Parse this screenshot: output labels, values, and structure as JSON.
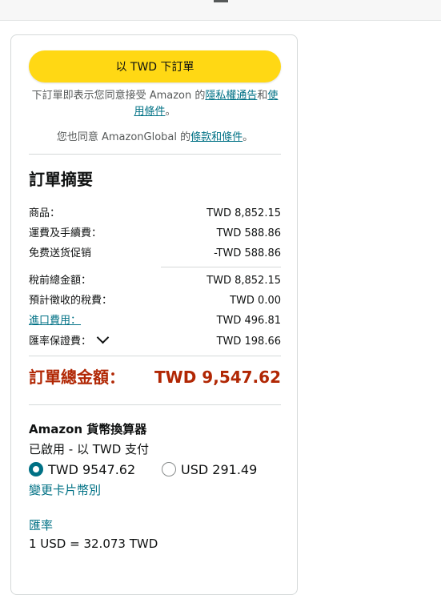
{
  "place_order": {
    "label": "以 TWD 下訂單"
  },
  "consent": {
    "prefix": "下訂單即表示您同意接受 Amazon 的",
    "privacy_link": "隱私權通告",
    "and": "和",
    "terms_link": "使用條件",
    "suffix": "。"
  },
  "global_consent": {
    "prefix": "您也同意 AmazonGlobal 的",
    "link": "條款和條件",
    "suffix": "。"
  },
  "summary": {
    "title": "訂單摘要",
    "rows": [
      {
        "label": "商品：",
        "value": "TWD 8,852.15"
      },
      {
        "label": "運費及手續費：",
        "value": "TWD 588.86"
      },
      {
        "label": "免费送货促销",
        "value": "-TWD 588.86"
      },
      {
        "label": "稅前總金額：",
        "value": "TWD 8,852.15"
      },
      {
        "label": "預計徵收的稅費：",
        "value": "TWD 0.00"
      },
      {
        "label": "進口費用：",
        "value": "TWD 496.81"
      },
      {
        "label": "匯率保證費：",
        "value": "TWD 198.66"
      }
    ],
    "total_label": "訂單總金額：",
    "total_value": "TWD 9,547.62"
  },
  "converter": {
    "title": "Amazon 貨幣換算器",
    "status": "已啟用 - 以 TWD 支付",
    "options": [
      {
        "label": "TWD 9547.62",
        "selected": true
      },
      {
        "label": "USD 291.49",
        "selected": false
      }
    ],
    "change_link": "變更卡片幣別",
    "rate_label": "匯率",
    "rate_value": "1 USD = 32.073 TWD"
  },
  "colors": {
    "button": "#ffd814",
    "link": "#007185",
    "total": "#b12704"
  }
}
